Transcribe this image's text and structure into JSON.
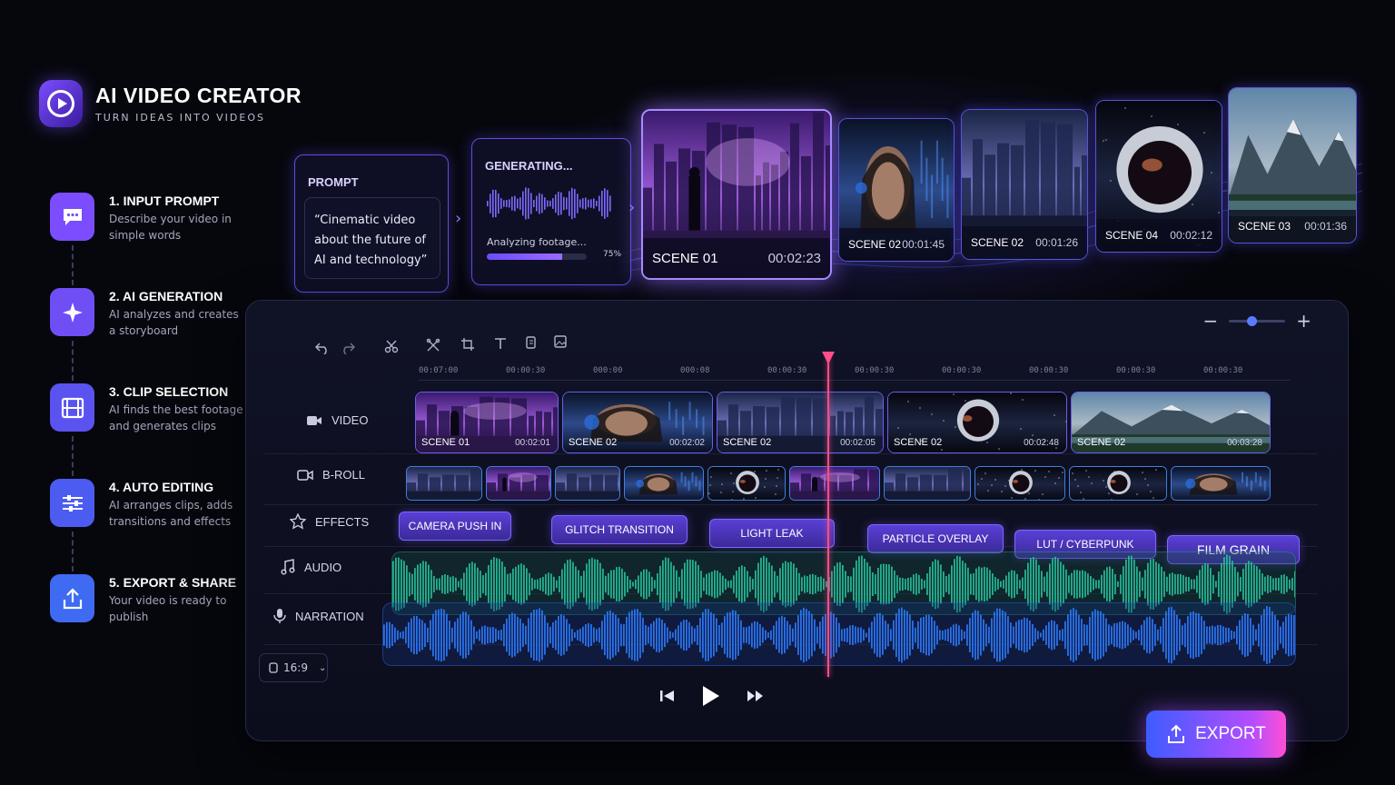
{
  "app": {
    "title": "AI VIDEO CREATOR",
    "subtitle": "TURN IDEAS INTO VIDEOS"
  },
  "steps": [
    {
      "title": "1. INPUT PROMPT",
      "desc": "Describe your video in simple words",
      "icon": "chat-icon",
      "color": "#7b4dff"
    },
    {
      "title": "2. AI GENERATION",
      "desc": "AI analyzes and creates a storyboard",
      "icon": "sparkle-icon",
      "color": "#6f4ef5"
    },
    {
      "title": "3. CLIP SELECTION",
      "desc": "AI finds the best footage and generates clips",
      "icon": "film-icon",
      "color": "#5a53f0"
    },
    {
      "title": "4. AUTO EDITING",
      "desc": "AI arranges clips, adds transitions and effects",
      "icon": "sliders-icon",
      "color": "#4d5cf0"
    },
    {
      "title": "5. EXPORT & SHARE",
      "desc": "Your video is ready to publish",
      "icon": "share-icon",
      "color": "#3f6bf2"
    }
  ],
  "prompt": {
    "heading": "PROMPT",
    "text": "“Cinematic video about the future of AI and technology”"
  },
  "generating": {
    "heading": "GENERATING...",
    "status": "Analyzing footage...",
    "percent_label": "75%",
    "progress": 0.75
  },
  "scenes": [
    {
      "label": "SCENE 01",
      "time": "00:02:23",
      "thumb": "city"
    },
    {
      "label": "SCENE 02",
      "time": "00:01:45",
      "thumb": "face"
    },
    {
      "label": "SCENE 02",
      "time": "00:01:26",
      "thumb": "city2"
    },
    {
      "label": "SCENE 04",
      "time": "00:02:12",
      "thumb": "astro"
    },
    {
      "label": "SCENE 03",
      "time": "00:01:36",
      "thumb": "mountain"
    }
  ],
  "editor": {
    "ruler_ticks": [
      "00:07:00",
      "00:00:30",
      "000:00",
      "000:08",
      "00:00:30",
      "00:00:30",
      "00:00:30",
      "00:00:30",
      "00:00:30",
      "00:00:30"
    ],
    "tracks": {
      "video": "VIDEO",
      "broll": "B-ROLL",
      "effects": "EFFECTS",
      "audio": "AUDIO",
      "narration": "NARRATION"
    },
    "video_clips": [
      {
        "label": "SCENE 01",
        "time": "00:02:01",
        "thumb": "city"
      },
      {
        "label": "SCENE 02",
        "time": "00:02:02",
        "thumb": "face"
      },
      {
        "label": "SCENE 02",
        "time": "00:02:05",
        "thumb": "city2"
      },
      {
        "label": "SCENE 02",
        "time": "00:02:48",
        "thumb": "astro"
      },
      {
        "label": "SCENE 02",
        "time": "00:03:28",
        "thumb": "mountain"
      }
    ],
    "effects": [
      "CAMERA PUSH IN",
      "GLITCH TRANSITION",
      "LIGHT LEAK",
      "PARTICLE OVERLAY",
      "LUT / CYBERPUNK",
      "FILM GRAIN"
    ],
    "aspect": "16:9",
    "zoom_level": 0.4,
    "playhead_position": 0.46,
    "export_label": "EXPORT"
  },
  "colors": {
    "accent": "#7b4dff",
    "playhead": "#ff4e88",
    "audio_wave": "#27c29a",
    "narration_wave": "#2e7bff"
  }
}
